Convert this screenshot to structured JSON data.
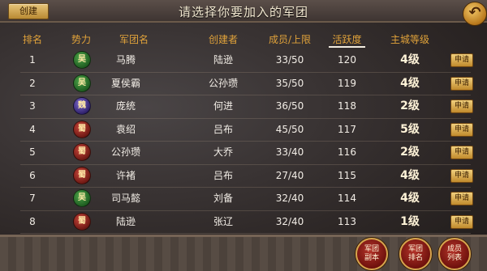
{
  "header": {
    "create_label": "创建",
    "title": "请选择你要加入的军团",
    "back_icon": "back-arrow-icon"
  },
  "columns": [
    "排名",
    "势力",
    "军团名",
    "创建者",
    "成员/上限",
    "活跃度",
    "主城等级"
  ],
  "sorted_column": "活跃度",
  "rows": [
    {
      "rank": "1",
      "faction": "吴",
      "faction_color": "green",
      "name": "马腾",
      "creator": "陆逊",
      "members": "33/50",
      "activity": "120",
      "level": "4级",
      "apply": "申请"
    },
    {
      "rank": "2",
      "faction": "吴",
      "faction_color": "green",
      "name": "夏侯霸",
      "creator": "公孙瓒",
      "members": "35/50",
      "activity": "119",
      "level": "4级",
      "apply": "申请"
    },
    {
      "rank": "3",
      "faction": "魏",
      "faction_color": "purple",
      "name": "庞统",
      "creator": "何进",
      "members": "36/50",
      "activity": "118",
      "level": "2级",
      "apply": "申请"
    },
    {
      "rank": "4",
      "faction": "蜀",
      "faction_color": "red",
      "name": "袁绍",
      "creator": "吕布",
      "members": "45/50",
      "activity": "117",
      "level": "5级",
      "apply": "申请"
    },
    {
      "rank": "5",
      "faction": "蜀",
      "faction_color": "red",
      "name": "公孙瓒",
      "creator": "大乔",
      "members": "33/40",
      "activity": "116",
      "level": "2级",
      "apply": "申请"
    },
    {
      "rank": "6",
      "faction": "蜀",
      "faction_color": "red",
      "name": "许褚",
      "creator": "吕布",
      "members": "27/40",
      "activity": "115",
      "level": "4级",
      "apply": "申请"
    },
    {
      "rank": "7",
      "faction": "吴",
      "faction_color": "green",
      "name": "司马懿",
      "creator": "刘备",
      "members": "32/40",
      "activity": "114",
      "level": "4级",
      "apply": "申请"
    },
    {
      "rank": "8",
      "faction": "蜀",
      "faction_color": "red",
      "name": "陆逊",
      "creator": "张辽",
      "members": "32/40",
      "activity": "113",
      "level": "1级",
      "apply": "申请"
    }
  ],
  "bottom_buttons": [
    {
      "line1": "军团",
      "line2": "副本"
    },
    {
      "line1": "军团",
      "line2": "排名"
    },
    {
      "line1": "成员",
      "line2": "列表"
    }
  ]
}
